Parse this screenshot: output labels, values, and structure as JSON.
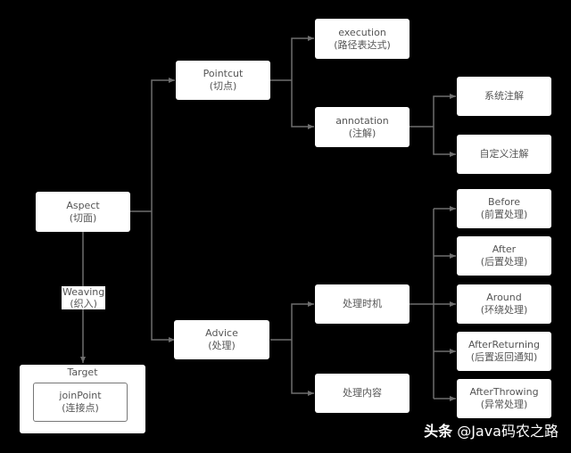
{
  "diagram": {
    "nodes": {
      "aspect": {
        "title": "Aspect",
        "subtitle": "(切面)"
      },
      "pointcut": {
        "title": "Pointcut",
        "subtitle": "(切点)"
      },
      "advice": {
        "title": "Advice",
        "subtitle": "(处理)"
      },
      "execution": {
        "title": "execution",
        "subtitle": "(路径表达式)"
      },
      "annotation": {
        "title": "annotation",
        "subtitle": "(注解)"
      },
      "system_annotation": {
        "title": "系统注解"
      },
      "custom_annotation": {
        "title": "自定义注解"
      },
      "timing": {
        "title": "处理时机"
      },
      "content": {
        "title": "处理内容"
      },
      "before": {
        "title": "Before",
        "subtitle": "(前置处理)"
      },
      "after": {
        "title": "After",
        "subtitle": "(后置处理)"
      },
      "around": {
        "title": "Around",
        "subtitle": "(环绕处理)"
      },
      "after_returning": {
        "title": "AfterReturning",
        "subtitle": "(后置返回通知)"
      },
      "after_throwing": {
        "title": "AfterThrowing",
        "subtitle": "(异常处理)"
      },
      "target": {
        "title": "Target"
      },
      "join_point": {
        "title": "joinPoint",
        "subtitle": "(连接点)"
      }
    },
    "edge_labels": {
      "weaving": {
        "title": "Weaving",
        "subtitle": "(织入)"
      }
    },
    "edges": [
      [
        "aspect",
        "pointcut"
      ],
      [
        "aspect",
        "advice"
      ],
      [
        "aspect",
        "target"
      ],
      [
        "pointcut",
        "execution"
      ],
      [
        "pointcut",
        "annotation"
      ],
      [
        "annotation",
        "system_annotation"
      ],
      [
        "annotation",
        "custom_annotation"
      ],
      [
        "advice",
        "timing"
      ],
      [
        "advice",
        "content"
      ],
      [
        "timing",
        "before"
      ],
      [
        "timing",
        "after"
      ],
      [
        "timing",
        "around"
      ],
      [
        "timing",
        "after_returning"
      ],
      [
        "timing",
        "after_throwing"
      ]
    ],
    "line_color": "#6e6e6e"
  },
  "watermark": {
    "prefix": "头条",
    "handle": "@Java码农之路"
  }
}
